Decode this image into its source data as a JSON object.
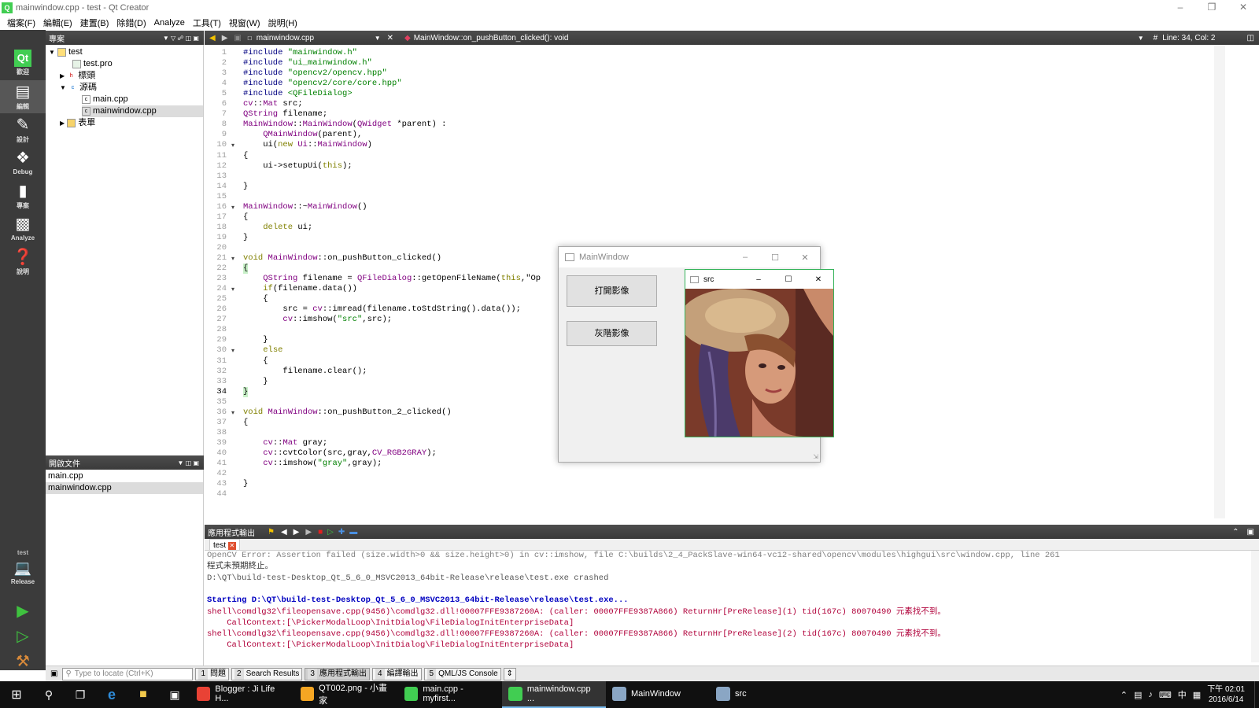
{
  "window": {
    "title": "mainwindow.cpp - test - Qt Creator"
  },
  "menu": [
    "檔案(F)",
    "編輯(E)",
    "建置(B)",
    "除錯(D)",
    "Analyze",
    "工具(T)",
    "視窗(W)",
    "說明(H)"
  ],
  "modes": [
    {
      "label": "歡迎",
      "icon": "qt-logo-icon"
    },
    {
      "label": "編輯",
      "icon": "edit-icon"
    },
    {
      "label": "設計",
      "icon": "design-icon"
    },
    {
      "label": "Debug",
      "icon": "debug-icon"
    },
    {
      "label": "專案",
      "icon": "projects-icon"
    },
    {
      "label": "Analyze",
      "icon": "analyze-icon"
    },
    {
      "label": "說明",
      "icon": "help-icon"
    }
  ],
  "kit": {
    "project": "test",
    "config": "Release"
  },
  "projects_panel": {
    "title": "專案",
    "tree": [
      {
        "label": "test",
        "level": 0,
        "expanded": true
      },
      {
        "label": "test.pro",
        "level": 1
      },
      {
        "label": "標頭",
        "level": 1,
        "expanded": false
      },
      {
        "label": "源碼",
        "level": 1,
        "expanded": true
      },
      {
        "label": "main.cpp",
        "level": 2
      },
      {
        "label": "mainwindow.cpp",
        "level": 2,
        "selected": true
      },
      {
        "label": "表單",
        "level": 1,
        "expanded": false
      }
    ]
  },
  "open_docs": {
    "title": "開啟文件",
    "items": [
      "main.cpp",
      "mainwindow.cpp"
    ]
  },
  "editor": {
    "file_tab": "mainwindow.cpp",
    "symbol": "MainWindow::on_pushButton_clicked(): void",
    "position": "Line: 34, Col: 2",
    "lines": [
      "#include \"mainwindow.h\"",
      "#include \"ui_mainwindow.h\"",
      "#include \"opencv2/opencv.hpp\"",
      "#include \"opencv2/core/core.hpp\"",
      "#include <QFileDialog>",
      "cv::Mat src;",
      "QString filename;",
      "MainWindow::MainWindow(QWidget *parent) :",
      "    QMainWindow(parent),",
      "    ui(new Ui::MainWindow)",
      "{",
      "    ui->setupUi(this);",
      "",
      "}",
      "",
      "MainWindow::~MainWindow()",
      "{",
      "    delete ui;",
      "}",
      "",
      "void MainWindow::on_pushButton_clicked()",
      "{",
      "    QString filename = QFileDialog::getOpenFileName(this,\"Op",
      "    if(filename.data())",
      "    {",
      "        src = cv::imread(filename.toStdString().data());",
      "        cv::imshow(\"src\",src);",
      "",
      "    }",
      "    else",
      "    {",
      "        filename.clear();",
      "    }",
      "}",
      "",
      "void MainWindow::on_pushButton_2_clicked()",
      "{",
      "",
      "    cv::Mat gray;",
      "    cv::cvtColor(src,gray,CV_RGB2GRAY);",
      "    cv::imshow(\"gray\",gray);",
      "",
      "}",
      ""
    ],
    "line23_tail": ");"
  },
  "app_window": {
    "title": "MainWindow",
    "btn_open": "打開影像",
    "btn_gray": "灰階影像"
  },
  "src_window": {
    "title": "src"
  },
  "output_pane": {
    "title": "應用程式輸出",
    "tab": "test",
    "lines": [
      {
        "text": "OpenCV Error: Assertion failed (size.width>0 && size.height>0) in cv::imshow, file C:\\builds\\2_4_PackSlave-win64-vc12-shared\\opencv\\modules\\highgui\\src\\window.cpp, line 261",
        "color": "#7f7f7f"
      },
      {
        "text": "程式未預期終止。",
        "color": "#333333"
      },
      {
        "text": "D:\\QT\\build-test-Desktop_Qt_5_6_0_MSVC2013_64bit-Release\\release\\test.exe crashed",
        "color": "#555555"
      },
      {
        "text": "",
        "color": "#000000"
      },
      {
        "text": "Starting D:\\QT\\build-test-Desktop_Qt_5_6_0_MSVC2013_64bit-Release\\release\\test.exe...",
        "color": "#0000c0"
      },
      {
        "text": "shell\\comdlg32\\fileopensave.cpp(9456)\\comdlg32.dll!00007FFE9387260A: (caller: 00007FFE9387A866) ReturnHr[PreRelease](1) tid(167c) 80070490 元素找不到。",
        "color": "#b0003a"
      },
      {
        "text": "    CallContext:[\\PickerModalLoop\\InitDialog\\FileDialogInitEnterpriseData]",
        "color": "#b0003a"
      },
      {
        "text": "shell\\comdlg32\\fileopensave.cpp(9456)\\comdlg32.dll!00007FFE9387260A: (caller: 00007FFE9387A866) ReturnHr[PreRelease](2) tid(167c) 80070490 元素找不到。",
        "color": "#b0003a"
      },
      {
        "text": "    CallContext:[\\PickerModalLoop\\InitDialog\\FileDialogInitEnterpriseData]",
        "color": "#b0003a"
      }
    ]
  },
  "statusbar": {
    "locator_placeholder": "Type to locate (Ctrl+K)",
    "tabs": [
      {
        "num": "1",
        "label": "問題"
      },
      {
        "num": "2",
        "label": "Search Results"
      },
      {
        "num": "3",
        "label": "應用程式輸出"
      },
      {
        "num": "4",
        "label": "編譯輸出"
      },
      {
        "num": "5",
        "label": "QML/JS Console"
      }
    ]
  },
  "taskbar": {
    "items": [
      {
        "label": "Blogger : Ji Life H...",
        "color": "#e94235"
      },
      {
        "label": "QT002.png - 小畫家",
        "color": "#f5a623"
      },
      {
        "label": "main.cpp - myfirst...",
        "color": "#41cd52"
      },
      {
        "label": "mainwindow.cpp ...",
        "color": "#41cd52"
      },
      {
        "label": "MainWindow",
        "color": "#8aa6c4"
      },
      {
        "label": "src",
        "color": "#8aa6c4"
      }
    ],
    "time": "下午 02:01",
    "date": "2016/6/14",
    "ime": "中"
  }
}
